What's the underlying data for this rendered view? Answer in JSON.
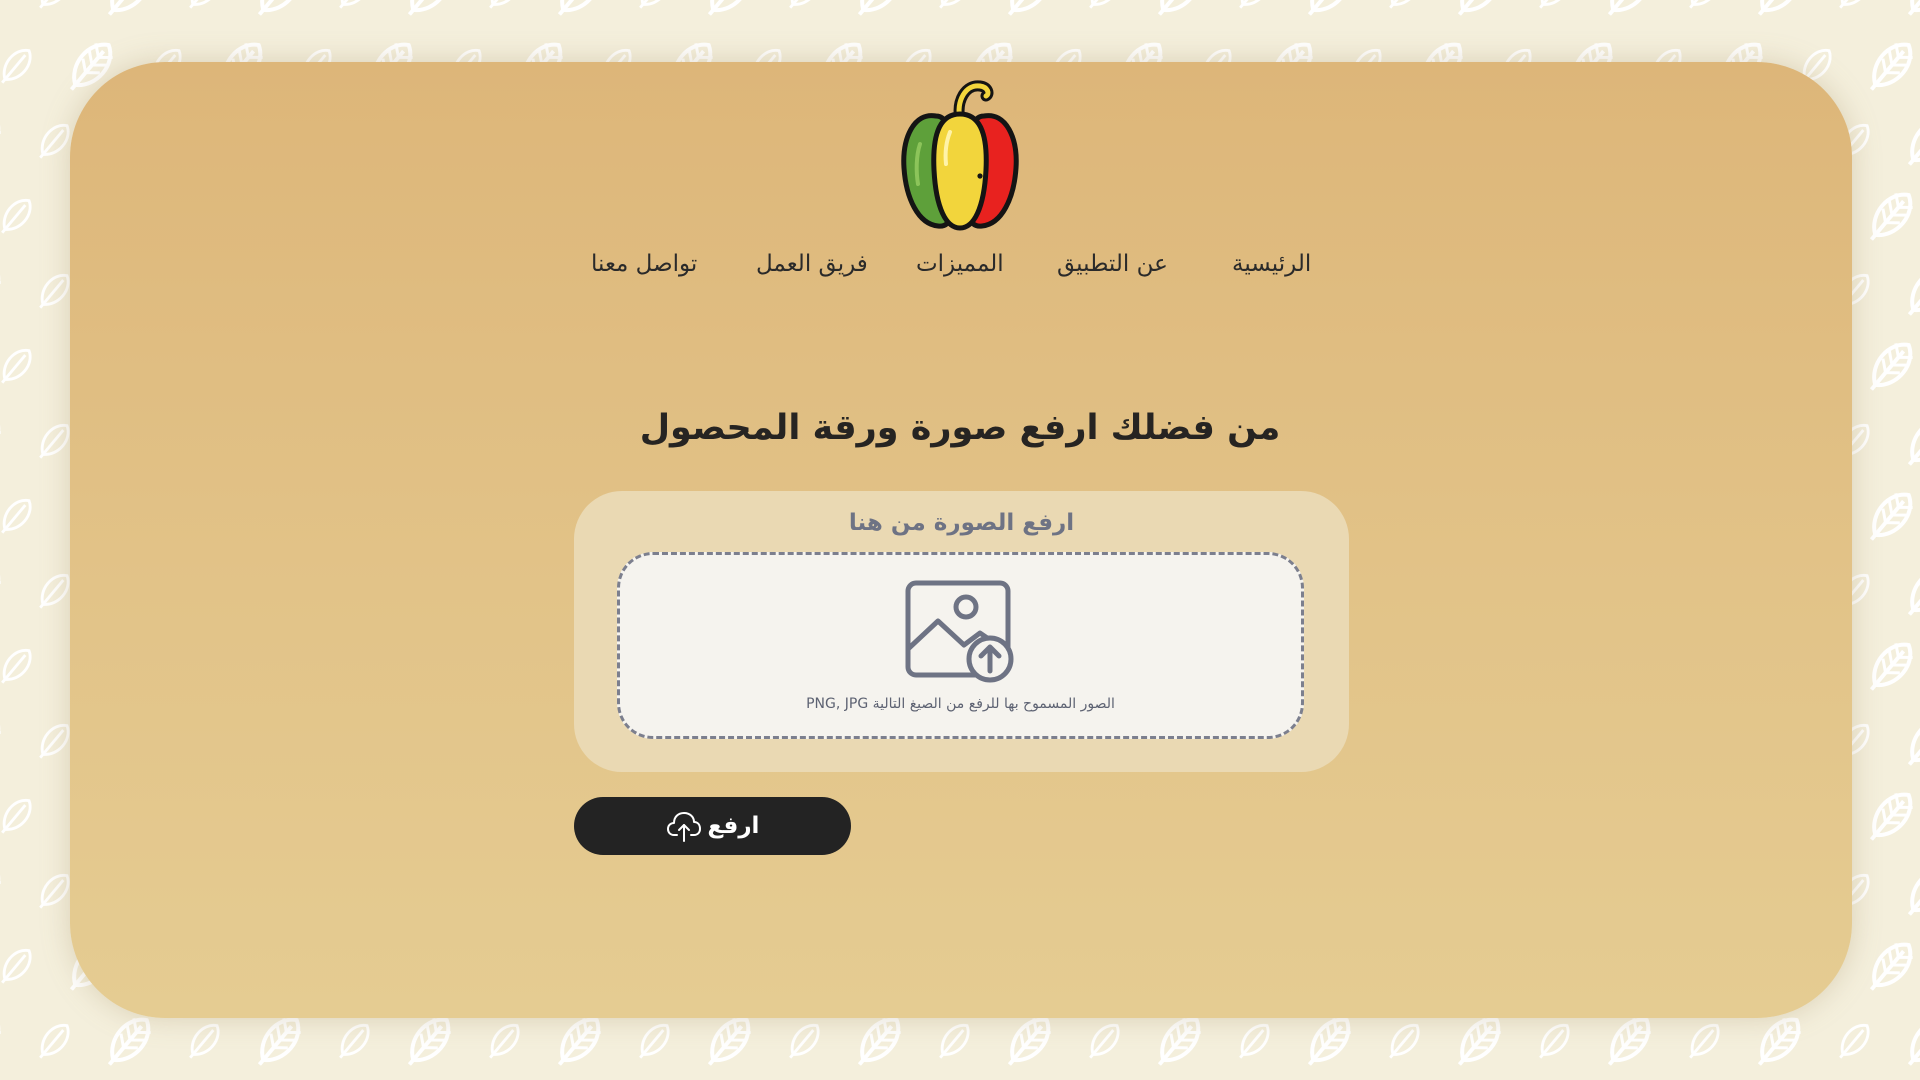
{
  "colors": {
    "page_background": "#f4efdc",
    "card_gradient_top": "#ddb679",
    "card_gradient_bottom": "#e5cc92",
    "upload_panel": "#ead9b3",
    "dropzone_fill": "#f5f3ee",
    "dropzone_border": "#7c7f8e",
    "button_background": "#232323",
    "button_text": "#ffffff",
    "heading_text": "#262422",
    "pepper_green": "#5ea03a",
    "pepper_yellow": "#f2d53c",
    "pepper_red": "#e8221f"
  },
  "logo": {
    "icon": "bell-pepper-icon"
  },
  "nav": {
    "items": [
      {
        "label": "الرئيسية",
        "id": "home"
      },
      {
        "label": "عن التطبيق",
        "id": "about"
      },
      {
        "label": "المميزات",
        "id": "features"
      },
      {
        "label": "فريق العمل",
        "id": "team"
      },
      {
        "label": "تواصل معنا",
        "id": "contact"
      }
    ]
  },
  "main": {
    "heading": "من فضلك ارفع صورة ورقة المحصول"
  },
  "upload": {
    "label": "ارفع الصورة من هنا",
    "icon": "image-upload-icon",
    "formats_text": "الصور المسموح بها للرفع من الصيغ التالية PNG, JPG",
    "button_label": "ارفع",
    "button_icon": "cloud-upload-icon"
  }
}
